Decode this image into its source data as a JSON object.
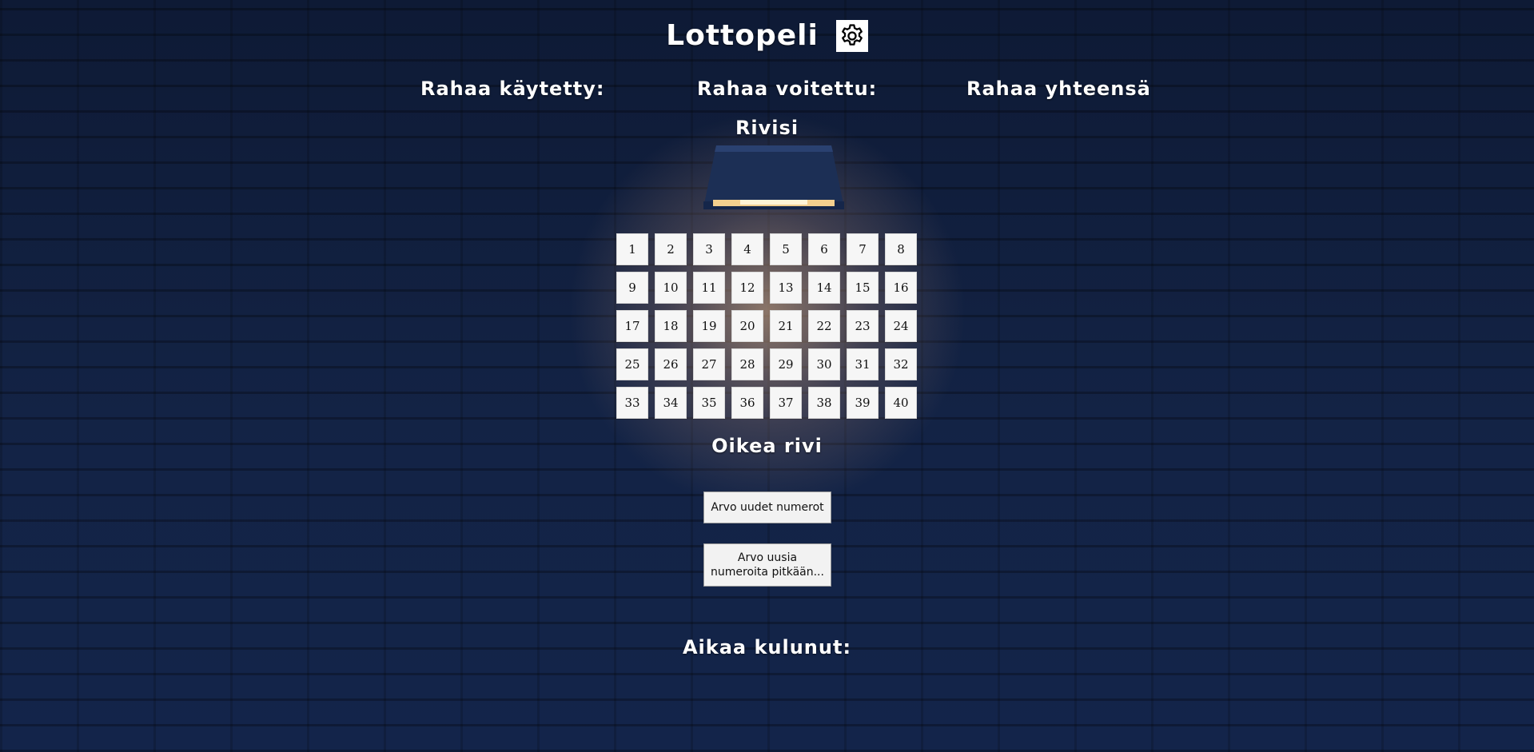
{
  "header": {
    "title": "Lottopeli",
    "settings_icon": "gear-icon"
  },
  "stats": {
    "spent_label": "Rahaa käytetty:",
    "won_label": "Rahaa voitettu:",
    "total_label": "Rahaa yhteensä"
  },
  "row_heading": "Rivisi",
  "numbers": [
    "1",
    "2",
    "3",
    "4",
    "5",
    "6",
    "7",
    "8",
    "9",
    "10",
    "11",
    "12",
    "13",
    "14",
    "15",
    "16",
    "17",
    "18",
    "19",
    "20",
    "21",
    "22",
    "23",
    "24",
    "25",
    "26",
    "27",
    "28",
    "29",
    "30",
    "31",
    "32",
    "33",
    "34",
    "35",
    "36",
    "37",
    "38",
    "39",
    "40"
  ],
  "correct_row_heading": "Oikea rivi",
  "buttons": {
    "draw": "Arvo uudet numerot",
    "draw_long": "Arvo uusia numeroita pitkään..."
  },
  "time_label": "Aikaa kulunut:"
}
